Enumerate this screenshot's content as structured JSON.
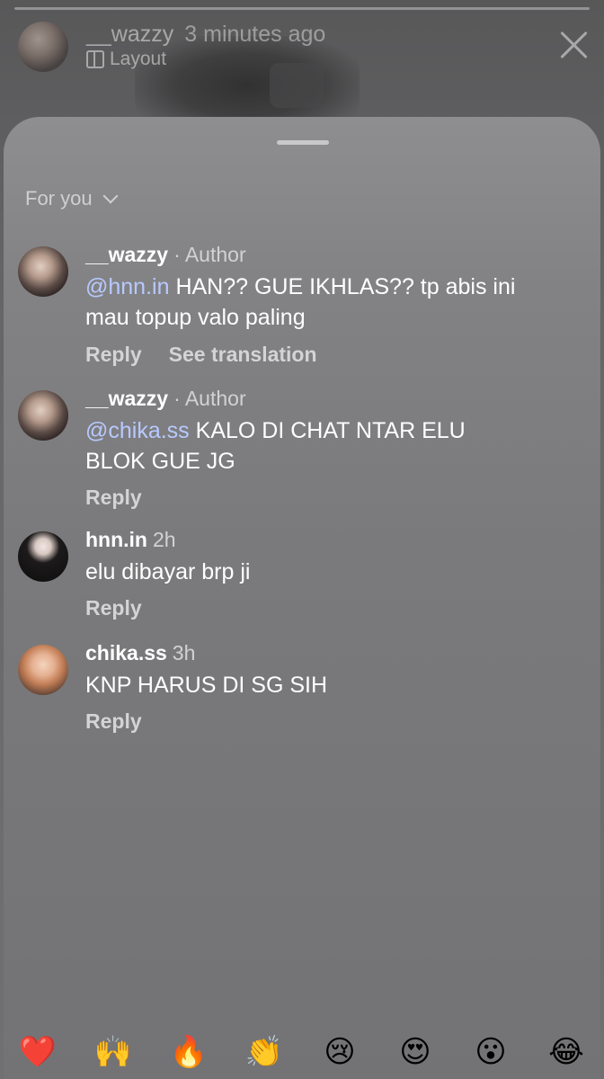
{
  "story": {
    "username": "__wazzy",
    "time": "3 minutes ago",
    "layout_label": "Layout"
  },
  "sheet": {
    "filter_label": "For you"
  },
  "comments": [
    {
      "username": "__wazzy",
      "meta": "· Author",
      "mention": "@hnn.in",
      "text": "HAN?? GUE IKHLAS?? tp abis ini mau topup valo paling",
      "reply_label": "Reply",
      "translate_label": "See translation"
    },
    {
      "username": "__wazzy",
      "meta": "· Author",
      "mention": "@chika.ss",
      "text": "KALO DI CHAT NTAR ELU BLOK GUE JG",
      "reply_label": "Reply"
    },
    {
      "username": "hnn.in",
      "meta": "2h",
      "text": "elu dibayar brp ji",
      "reply_label": "Reply"
    },
    {
      "username": "chika.ss",
      "meta": "3h",
      "text": "KNP HARUS DI SG SIH",
      "reply_label": "Reply"
    }
  ],
  "reactions": [
    "❤️",
    "🙌",
    "🔥",
    "👏",
    "😢",
    "😍",
    "😮",
    "😂"
  ],
  "colors": {
    "mention": "#b8c9ff",
    "sheet": "#7a7a7c",
    "text": "#ffffff"
  }
}
